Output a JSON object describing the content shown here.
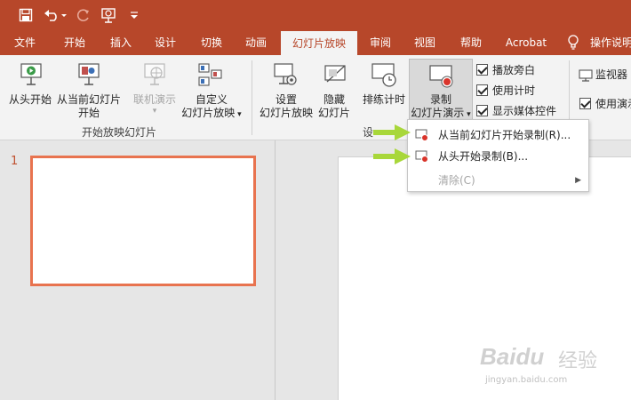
{
  "quick_access": {
    "save_icon": "save-icon",
    "undo_icon": "undo-icon",
    "redo_icon": "redo-icon",
    "present_icon": "present-from-start-icon",
    "customize_icon": "customize-qat-icon"
  },
  "tabs": [
    {
      "label": "文件"
    },
    {
      "label": "开始"
    },
    {
      "label": "插入"
    },
    {
      "label": "设计"
    },
    {
      "label": "切换"
    },
    {
      "label": "动画"
    },
    {
      "label": "幻灯片放映"
    },
    {
      "label": "审阅"
    },
    {
      "label": "视图"
    },
    {
      "label": "帮助"
    },
    {
      "label": "Acrobat"
    },
    {
      "label": "操作说明"
    }
  ],
  "ribbon": {
    "start_group": {
      "from_beginning": "从头开始",
      "from_current_line1": "从当前幻灯片",
      "from_current_line2": "开始",
      "online": "联机演示",
      "custom_line1": "自定义",
      "custom_line2": "幻灯片放映",
      "label": "开始放映幻灯片"
    },
    "setup_group": {
      "setup_line1": "设置",
      "setup_line2": "幻灯片放映",
      "hide_line1": "隐藏",
      "hide_line2": "幻灯片",
      "rehearse": "排练计时",
      "record_line1": "录制",
      "record_line2": "幻灯片演示",
      "label": "设"
    },
    "checks": {
      "narration": "播放旁白",
      "timings": "使用计时",
      "media_controls": "显示媒体控件"
    },
    "monitor": {
      "monitor_label": "监视器",
      "use_presenter": "使用演示"
    }
  },
  "dropdown": {
    "items": [
      {
        "label": "从当前幻灯片开始录制(R)..."
      },
      {
        "label": "从头开始录制(B)..."
      },
      {
        "label": "清除(C)"
      }
    ]
  },
  "slides": {
    "number": "1"
  },
  "colors": {
    "accent": "#b7472a",
    "thumb_border": "#e8734f",
    "arrow": "#9acd32"
  },
  "watermark": {
    "brand": "Baidu",
    "suffix": "经验",
    "url": "jingyan.baidu.com"
  }
}
